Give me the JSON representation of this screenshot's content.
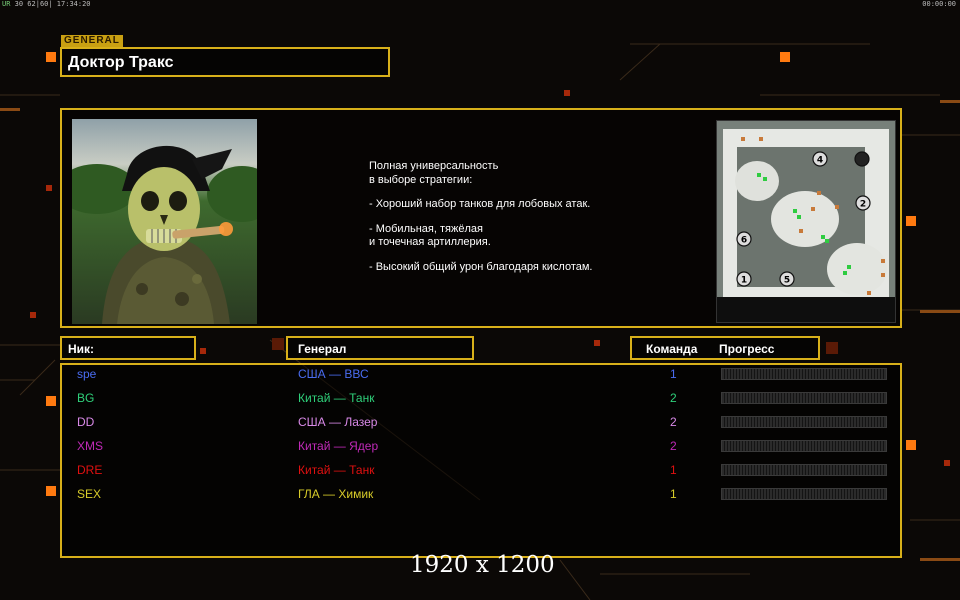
{
  "hud": {
    "left_level": "UR",
    "left_stats": "30 62|60| 17:34:20",
    "right_clock": "00:00:00"
  },
  "general_tag": "GENERAL",
  "general_name": "Доктор Тракс",
  "description": [
    "Полная универсальность",
    "в выборе стратегии:",
    "",
    "- Хороший набор танков для лобовых атак.",
    "",
    "- Мобильная, тяжёлая",
    "и точечная артиллерия.",
    "",
    "- Высокий общий урон благодаря кислотам."
  ],
  "minimap": {
    "start_positions": [
      "4",
      "2",
      "6",
      "1",
      "5"
    ]
  },
  "table_headers": {
    "nick": "Ник:",
    "general": "Генерал",
    "team": "Команда",
    "progress": "Прогресс"
  },
  "players": [
    {
      "nick": "spe",
      "general": "США — ВВС",
      "team": "1",
      "color": "#4a6cf0",
      "progress": 0
    },
    {
      "nick": "BG",
      "general": "Китай — Танк",
      "team": "2",
      "color": "#2fd07a",
      "progress": 0
    },
    {
      "nick": "DD",
      "general": "США — Лазер",
      "team": "2",
      "color": "#d98ae8",
      "progress": 0
    },
    {
      "nick": "XMS",
      "general": "Китай — Ядер",
      "team": "2",
      "color": "#c02ab8",
      "progress": 0
    },
    {
      "nick": "DRE",
      "general": "Китай — Танк",
      "team": "1",
      "color": "#e01010",
      "progress": 0
    },
    {
      "nick": "SEX",
      "general": "ГЛА — Химик",
      "team": "1",
      "color": "#d8cc2a",
      "progress": 0
    }
  ],
  "colors": {
    "accent": "#d8b01a",
    "orange_light": "#ff7a10"
  },
  "resolution_label": "1920 x 1200"
}
